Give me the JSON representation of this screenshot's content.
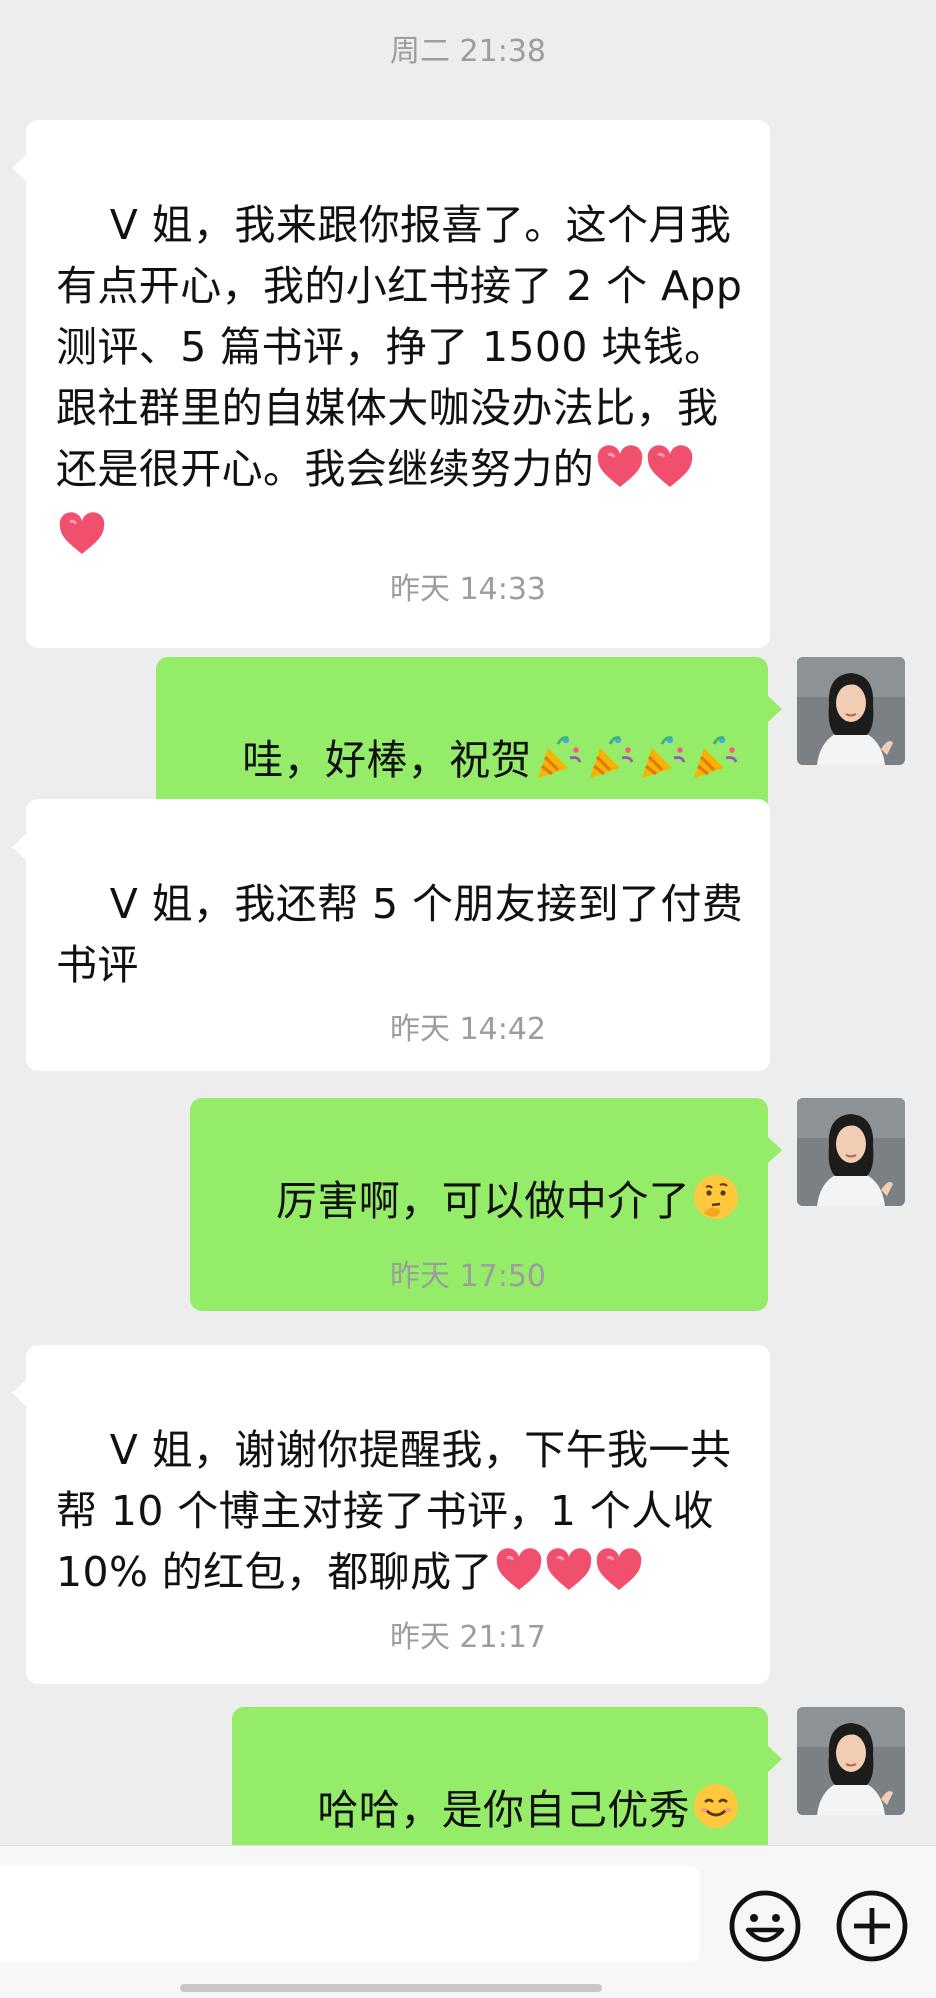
{
  "timestamps": {
    "t1": "周二 21:38",
    "t2": "昨天 14:33",
    "t3": "昨天 14:42",
    "t4": "昨天 17:50",
    "t5": "昨天 21:17"
  },
  "messages": {
    "m1": {
      "side": "left",
      "text": "V 姐，我来跟你报喜了。这个月我有点开心，我的小红书接了 2 个 App 测评、5 篇书评，挣了 1500 块钱。跟社群里的自媒体大咖没办法比，我还是很开心。我会继续努力的",
      "emoji": "heart-icon ×3"
    },
    "m2": {
      "side": "right",
      "text": "哇，好棒，祝贺",
      "emoji": "party-popper-icon ×4"
    },
    "m3": {
      "side": "left",
      "text": "V 姐，我还帮 5 个朋友接到了付费书评"
    },
    "m4": {
      "side": "right",
      "text": "厉害啊，可以做中介了",
      "emoji": "thinking-face-icon"
    },
    "m5": {
      "side": "left",
      "text": "V 姐，谢谢你提醒我，下午我一共帮 10 个博主对接了书评，1 个人收 10% 的红包，都聊成了",
      "emoji": "heart-icon ×3"
    },
    "m6": {
      "side": "right",
      "text": "哈哈，是你自己优秀",
      "emoji": "smiling-face-icon"
    }
  },
  "colors": {
    "background": "#ededed",
    "sent_bubble": "#95ec69",
    "received_bubble": "#ffffff",
    "timestamp_text": "#9d9d9d",
    "heart": "#f0506e"
  },
  "input_bar": {
    "buttons": [
      "emoji-button",
      "plus-button"
    ]
  }
}
